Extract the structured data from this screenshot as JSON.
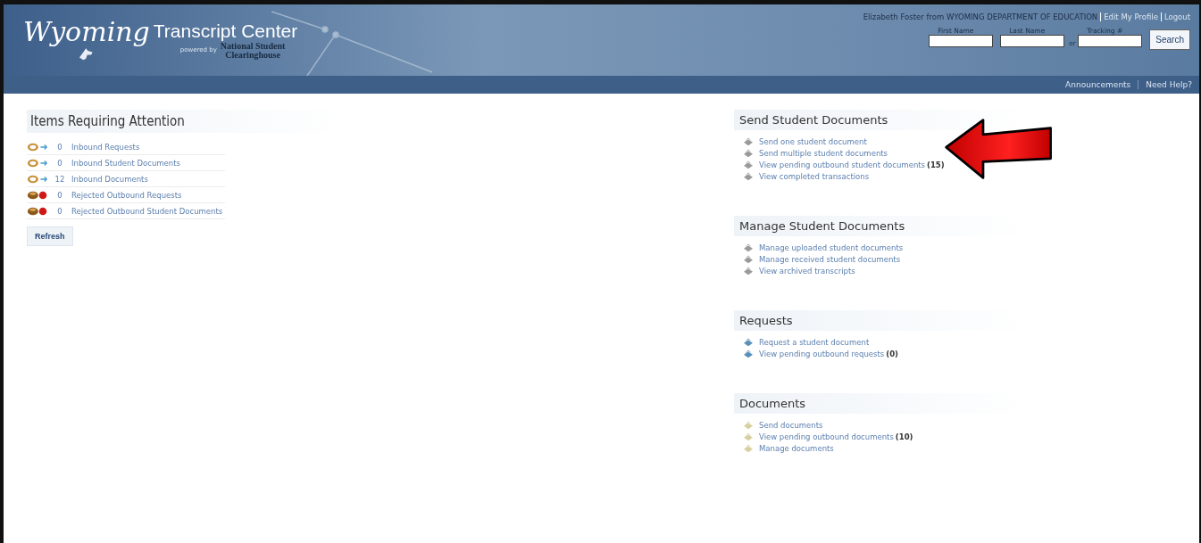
{
  "logo": {
    "script": "Wyoming",
    "title": "Transcript Center",
    "powered_by": "powered by",
    "org_line1": "National Student",
    "org_line2": "Clearinghouse"
  },
  "user_bar": {
    "text": "Elizabeth Foster from WYOMING DEPARTMENT OF EDUCATION",
    "links": [
      "Edit My Profile",
      "Logout"
    ]
  },
  "search": {
    "first_name_label": "First Name",
    "last_name_label": "Last Name",
    "or": "or",
    "tracking_label": "Tracking #",
    "button": "Search"
  },
  "nav": [
    "Announcements",
    "Need Help?"
  ],
  "attention": {
    "title": "Items Requiring Attention",
    "items": [
      {
        "kind": "inbound",
        "count": "0",
        "label": "Inbound Requests"
      },
      {
        "kind": "inbound",
        "count": "0",
        "label": "Inbound Student Documents"
      },
      {
        "kind": "inbound",
        "count": "12",
        "label": "Inbound Documents"
      },
      {
        "kind": "rejected",
        "count": "0",
        "label": "Rejected Outbound Requests"
      },
      {
        "kind": "rejected",
        "count": "0",
        "label": "Rejected Outbound Student Documents"
      }
    ],
    "refresh": "Refresh"
  },
  "sections": [
    {
      "title": "Send Student Documents",
      "color": "#9a9a9a",
      "links": [
        {
          "label": "Send one student document"
        },
        {
          "label": "Send multiple student documents"
        },
        {
          "label": "View pending outbound student documents",
          "count": "(15)"
        },
        {
          "label": "View completed transactions"
        }
      ]
    },
    {
      "title": "Manage Student Documents",
      "color": "#9a9a9a",
      "links": [
        {
          "label": "Manage uploaded student documents"
        },
        {
          "label": "Manage received student documents"
        },
        {
          "label": "View archived transcripts"
        }
      ]
    },
    {
      "title": "Requests",
      "color": "#5a8fb8",
      "links": [
        {
          "label": "Request a student document"
        },
        {
          "label": "View pending outbound requests",
          "count": "(0)"
        }
      ]
    },
    {
      "title": "Documents",
      "color": "#d8cfa0",
      "links": [
        {
          "label": "Send documents"
        },
        {
          "label": "View pending outbound documents",
          "count": "(10)"
        },
        {
          "label": "Manage documents"
        }
      ]
    }
  ]
}
